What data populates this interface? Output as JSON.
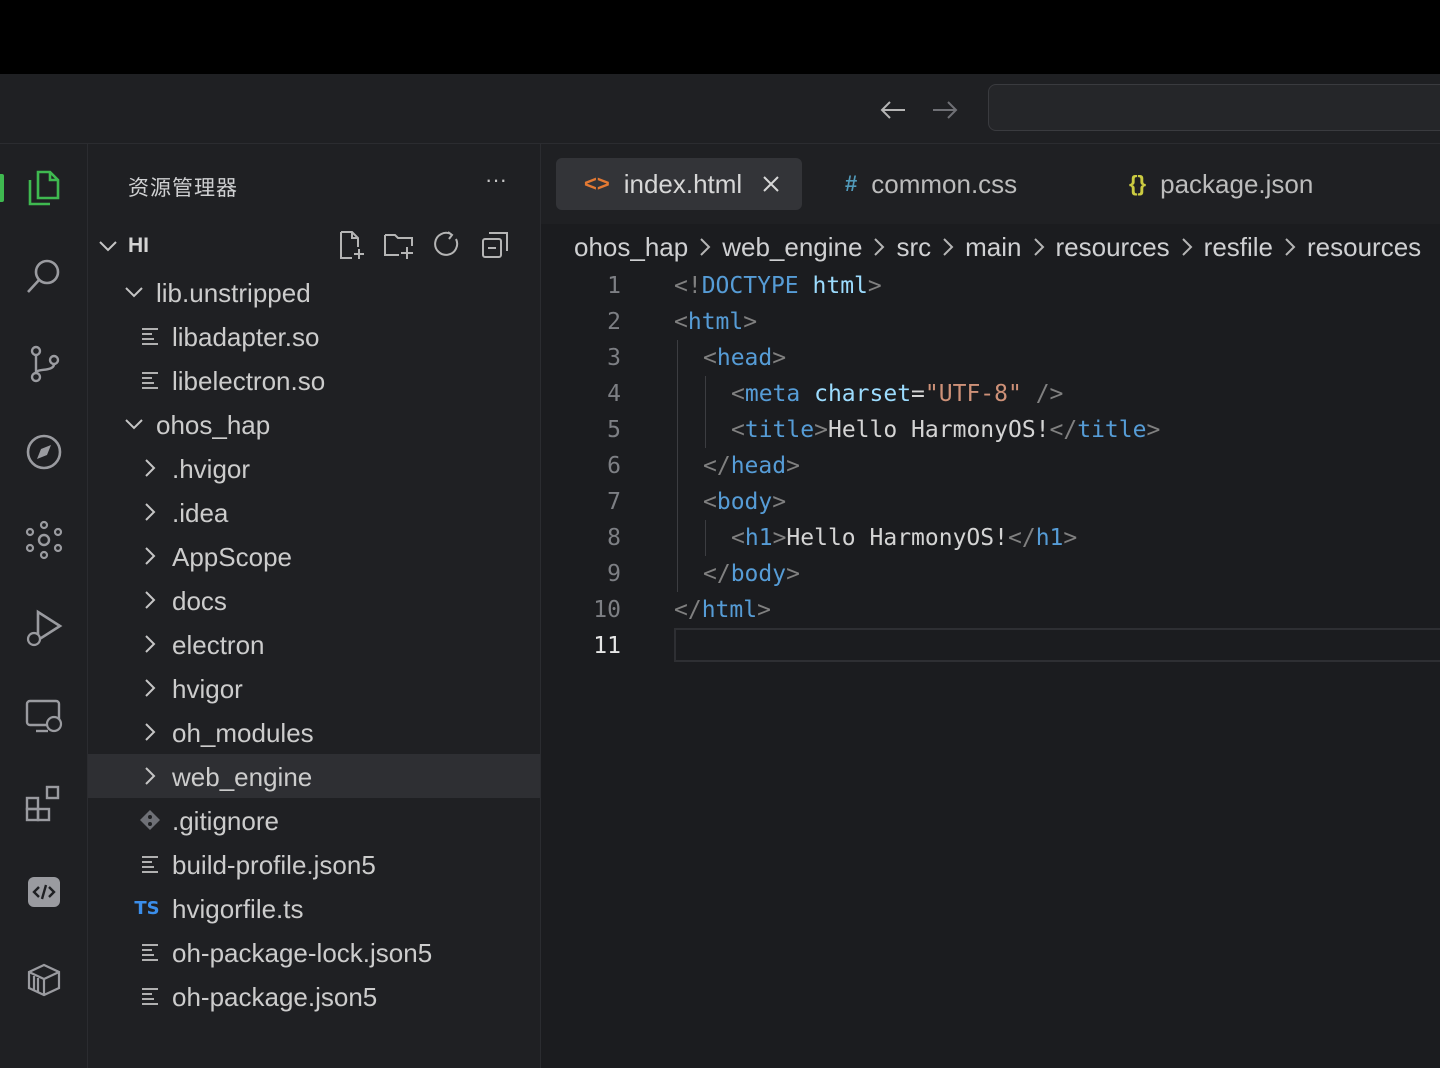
{
  "titlebar": {
    "back_icon": "arrow-left-icon",
    "forward_icon": "arrow-right-icon",
    "search_value": ""
  },
  "activity_bar": [
    {
      "name": "explorer",
      "icon": "files-icon",
      "active": true
    },
    {
      "name": "search",
      "icon": "search-icon"
    },
    {
      "name": "source-control",
      "icon": "source-control-icon"
    },
    {
      "name": "explore",
      "icon": "compass-icon"
    },
    {
      "name": "graph",
      "icon": "graph-icon"
    },
    {
      "name": "run-debug",
      "icon": "run-debug-icon"
    },
    {
      "name": "remote",
      "icon": "remote-explorer-icon"
    },
    {
      "name": "extensions",
      "icon": "extensions-icon"
    },
    {
      "name": "device",
      "icon": "device-code-icon"
    },
    {
      "name": "packages",
      "icon": "package-icon"
    }
  ],
  "sidebar": {
    "title": "资源管理器",
    "more": "···",
    "root": "HI",
    "tree": [
      {
        "label": "lib.unstripped",
        "kind": "folder-open",
        "depth": 1
      },
      {
        "label": "libadapter.so",
        "kind": "file",
        "depth": 2
      },
      {
        "label": "libelectron.so",
        "kind": "file",
        "depth": 2
      },
      {
        "label": "ohos_hap",
        "kind": "folder-open",
        "depth": 1
      },
      {
        "label": ".hvigor",
        "kind": "folder",
        "depth": 2
      },
      {
        "label": ".idea",
        "kind": "folder",
        "depth": 2
      },
      {
        "label": "AppScope",
        "kind": "folder",
        "depth": 2
      },
      {
        "label": "docs",
        "kind": "folder",
        "depth": 2
      },
      {
        "label": "electron",
        "kind": "folder",
        "depth": 2
      },
      {
        "label": "hvigor",
        "kind": "folder",
        "depth": 2
      },
      {
        "label": "oh_modules",
        "kind": "folder",
        "depth": 2
      },
      {
        "label": "web_engine",
        "kind": "folder",
        "depth": 2,
        "selected": true
      },
      {
        "label": ".gitignore",
        "kind": "git",
        "depth": 2
      },
      {
        "label": "build-profile.json5",
        "kind": "file",
        "depth": 2
      },
      {
        "label": "hvigorfile.ts",
        "kind": "ts",
        "depth": 2,
        "badge": "TS"
      },
      {
        "label": "oh-package-lock.json5",
        "kind": "file",
        "depth": 2
      },
      {
        "label": "oh-package.json5",
        "kind": "file",
        "depth": 2
      }
    ]
  },
  "tabs": [
    {
      "label": "index.html",
      "icon_text": "<>",
      "active": true
    },
    {
      "label": "common.css",
      "icon_text": "#"
    },
    {
      "label": "package.json",
      "icon_text": "{}"
    }
  ],
  "breadcrumb": [
    "ohos_hap",
    "web_engine",
    "src",
    "main",
    "resources",
    "resfile",
    "resources"
  ],
  "colors": {
    "tag": "#569cd6",
    "attribute": "#9cdcfe",
    "string": "#ce9178",
    "punctuation": "#808080",
    "html_icon": "#e37933",
    "css_icon": "#519aba",
    "json_icon": "#cbcb41",
    "active_indicator": "#3fb950"
  },
  "code": {
    "line_numbers": [
      "1",
      "2",
      "3",
      "4",
      "5",
      "6",
      "7",
      "8",
      "9",
      "10",
      "11"
    ],
    "current_line": 11
  }
}
